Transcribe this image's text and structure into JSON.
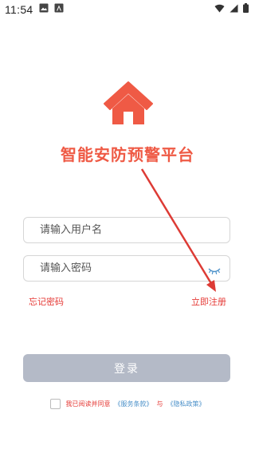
{
  "status_bar": {
    "time": "11:54",
    "icons_left": [
      "image-icon",
      "store-icon"
    ],
    "icons_right": [
      "wifi-icon",
      "signal-icon",
      "battery-icon"
    ]
  },
  "app": {
    "title": "智能安防预警平台",
    "logo_icon": "home-icon",
    "accent_color": "#ef5a45"
  },
  "form": {
    "username_placeholder": "请输入用户名",
    "username_value": "",
    "password_placeholder": "请输入密码",
    "password_value": "",
    "forgot_password_label": "忘记密码",
    "register_label": "立即注册",
    "login_label": "登录",
    "login_button_color": "#b4bac7"
  },
  "agreement": {
    "checked": false,
    "prefix": "我已阅读并同意",
    "terms_link": "《服务条款》",
    "and_text": "与",
    "privacy_link": "《隐私政策》"
  }
}
